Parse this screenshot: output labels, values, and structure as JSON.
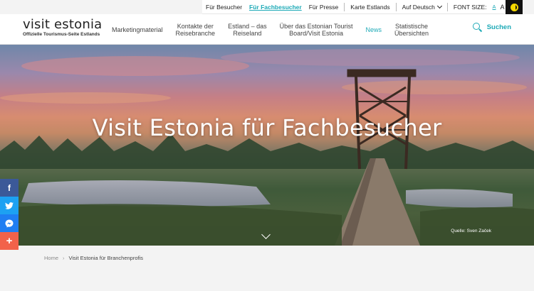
{
  "utility": {
    "items": [
      "Für Besucher",
      "Für Fachbesucher",
      "Für Presse",
      "Karte Estlands"
    ],
    "language": "Auf Deutsch",
    "font_size_label": "FONT SIZE:",
    "font_sizes": [
      "A",
      "A",
      "A"
    ]
  },
  "logo": {
    "title": "visit estonia",
    "subtitle": "Offizielle Tourismus-Seite Estlands"
  },
  "nav": {
    "items": [
      [
        "Marketingmaterial"
      ],
      [
        "Kontakte der",
        "Reisebranche"
      ],
      [
        "Estland – das",
        "Reiseland"
      ],
      [
        "Über das Estonian Tourist",
        "Board/Visit Estonia"
      ],
      [
        "News"
      ],
      [
        "Statistische",
        "Übersichten"
      ]
    ]
  },
  "search": {
    "label": "Suchen"
  },
  "hero": {
    "title": "Visit Estonia für Fachbesucher",
    "credit": "Quelle: Sven Začek"
  },
  "social": {
    "facebook": "f",
    "twitter": "t",
    "messenger": "m",
    "more": "+"
  },
  "breadcrumb": {
    "home": "Home",
    "current": "Visit Estonia für Branchenprofis"
  },
  "colors": {
    "accent": "#1eaab7",
    "facebook": "#3b5998",
    "twitter": "#1da1f2",
    "messenger": "#1f7ef2",
    "share": "#f2624a"
  }
}
